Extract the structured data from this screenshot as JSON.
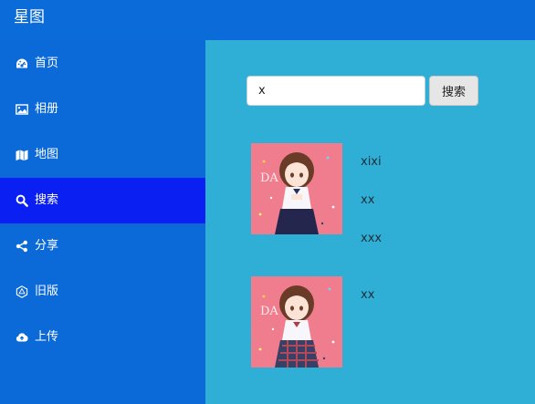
{
  "app": {
    "title": "星图"
  },
  "sidebar": {
    "items": [
      {
        "label": "首页",
        "icon": "dashboard-icon",
        "active": false
      },
      {
        "label": "相册",
        "icon": "image-icon",
        "active": false
      },
      {
        "label": "地图",
        "icon": "map-icon",
        "active": false
      },
      {
        "label": "搜索",
        "icon": "search-icon",
        "active": true
      },
      {
        "label": "分享",
        "icon": "share-icon",
        "active": false
      },
      {
        "label": "旧版",
        "icon": "hexagon-icon",
        "active": false
      },
      {
        "label": "上传",
        "icon": "cloud-upload-icon",
        "active": false
      }
    ]
  },
  "search": {
    "value": "x",
    "button_label": "搜索"
  },
  "results": [
    {
      "image_text": "DA ILL",
      "tags": [
        "xixi",
        "xx",
        "xxx"
      ]
    },
    {
      "image_text": "DA ILL",
      "tags": [
        "xx"
      ]
    }
  ],
  "colors": {
    "topbar": "#0b6bd9",
    "sidebar": "#0b6ad8",
    "active_item": "#0a1ff2",
    "main": "#30afd6",
    "thumbnail": "#ef7d8d"
  }
}
